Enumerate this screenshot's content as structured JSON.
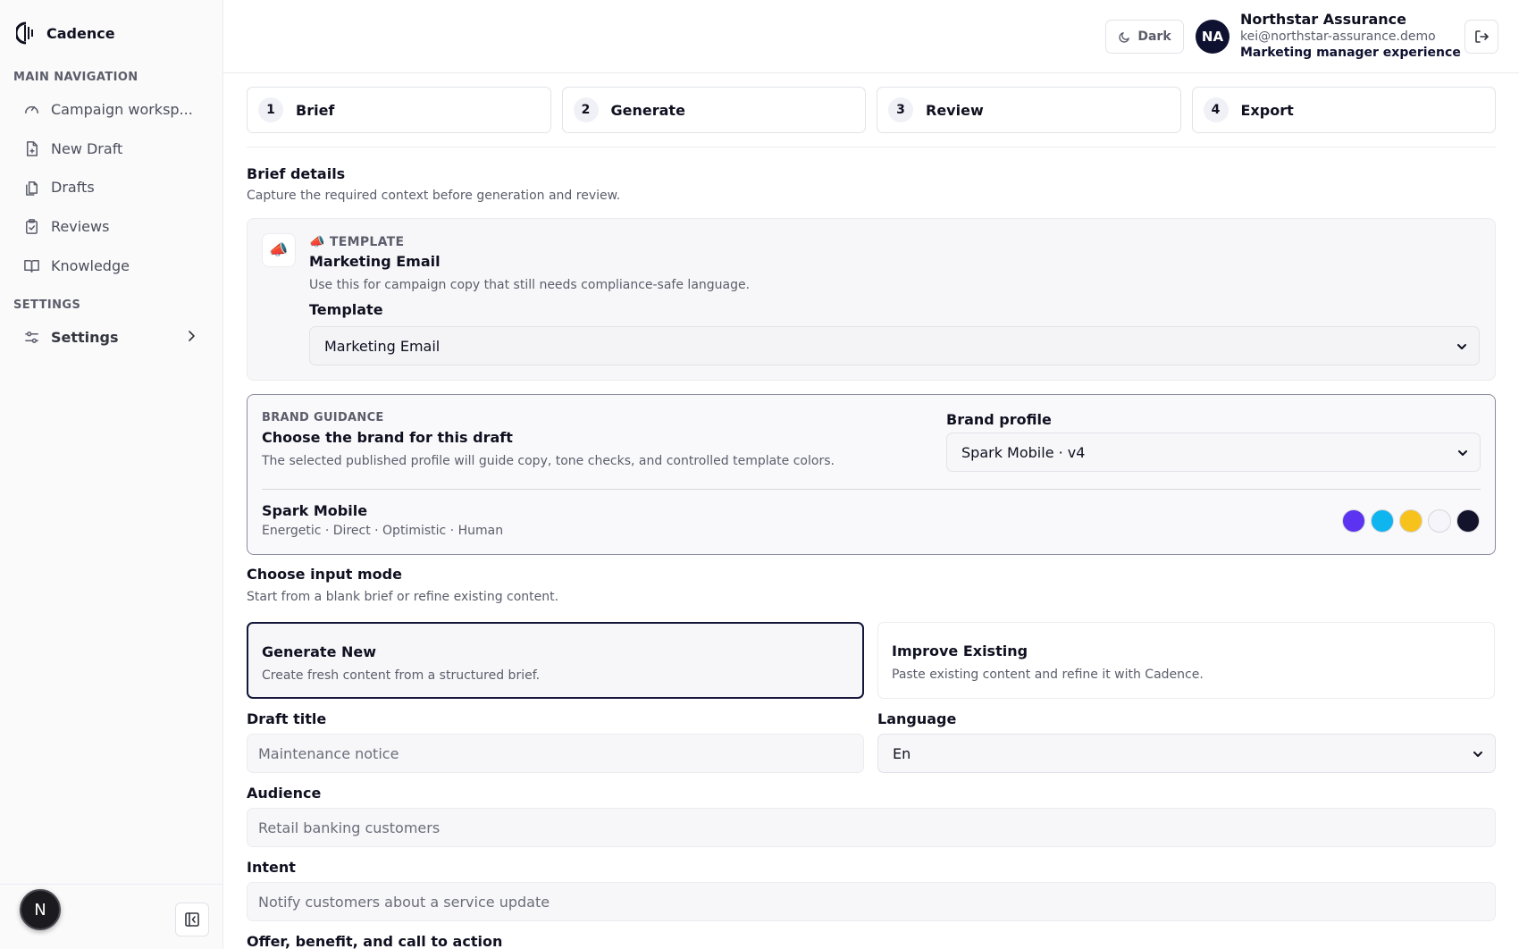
{
  "app": {
    "name": "Cadence"
  },
  "sidebar": {
    "main_heading": "MAIN NAVIGATION",
    "items": [
      {
        "label": "Campaign worksp...",
        "icon": "gauge-icon"
      },
      {
        "label": "New Draft",
        "icon": "file-plus-icon"
      },
      {
        "label": "Drafts",
        "icon": "files-icon"
      },
      {
        "label": "Reviews",
        "icon": "clipboard-check-icon"
      },
      {
        "label": "Knowledge",
        "icon": "book-open-icon"
      }
    ],
    "settings_heading": "SETTINGS",
    "settings_label": "Settings",
    "footer_avatar": "N"
  },
  "header": {
    "theme_label": "Dark",
    "user": {
      "initials": "NA",
      "org": "Northstar Assurance",
      "email": "kei@northstar-assurance.demo",
      "role": "Marketing manager experience"
    }
  },
  "steps": [
    {
      "num": "1",
      "label": "Brief"
    },
    {
      "num": "2",
      "label": "Generate"
    },
    {
      "num": "3",
      "label": "Review"
    },
    {
      "num": "4",
      "label": "Export"
    }
  ],
  "brief": {
    "title": "Brief details",
    "subtitle": "Capture the required context before generation and review."
  },
  "template": {
    "icon": "📣",
    "eyebrow": "📣 TEMPLATE",
    "name": "Marketing Email",
    "description": "Use this for campaign copy that still needs compliance-safe language.",
    "field_label": "Template",
    "selected": "Marketing Email"
  },
  "brand_guidance": {
    "eyebrow": "BRAND GUIDANCE",
    "title": "Choose the brand for this draft",
    "description": "The selected published profile will guide copy, tone checks, and controlled template colors.",
    "profile_label": "Brand profile",
    "profile_selected": "Spark Mobile · v4",
    "profile_name": "Spark Mobile",
    "tone": "Energetic · Direct · Optimistic · Human",
    "colors": [
      "#5b33f0",
      "#0fb5ee",
      "#f7c21b",
      "#f5f5fa",
      "#13132b"
    ]
  },
  "input_mode": {
    "title": "Choose input mode",
    "subtitle": "Start from a blank brief or refine existing content.",
    "options": [
      {
        "title": "Generate New",
        "desc": "Create fresh content from a structured brief.",
        "selected": true
      },
      {
        "title": "Improve Existing",
        "desc": "Paste existing content and refine it with Cadence.",
        "selected": false
      }
    ]
  },
  "fields": {
    "draft_title_label": "Draft title",
    "draft_title_placeholder": "Maintenance notice",
    "language_label": "Language",
    "language_value": "En",
    "audience_label": "Audience",
    "audience_placeholder": "Retail banking customers",
    "intent_label": "Intent",
    "intent_placeholder": "Notify customers about a service update",
    "offer_label": "Offer, benefit, and call to action"
  }
}
